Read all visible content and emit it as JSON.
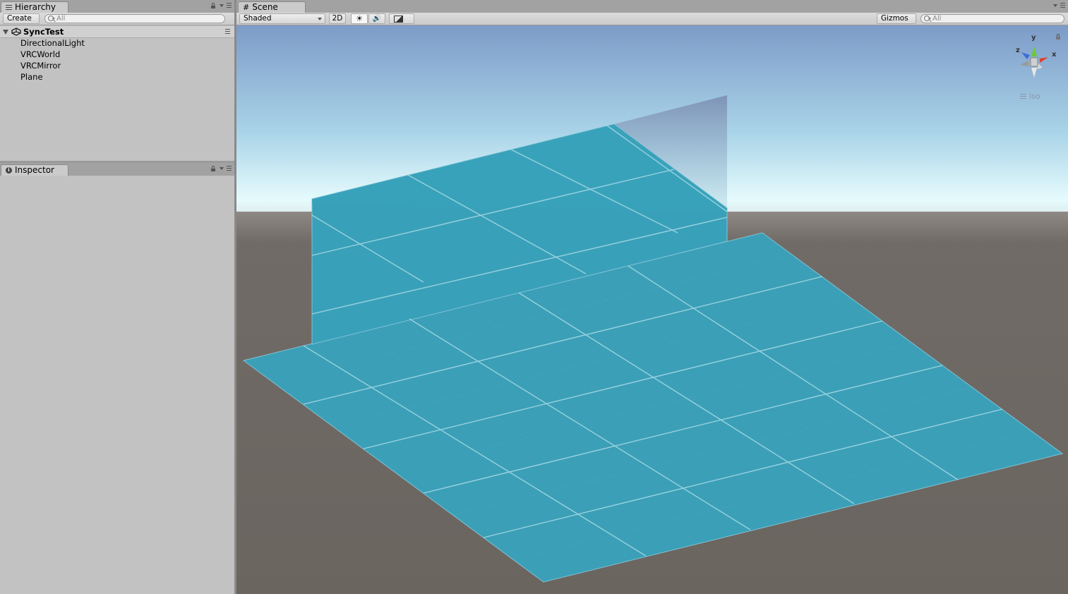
{
  "hierarchy": {
    "tab_label": "Hierarchy",
    "create_label": "Create",
    "search_placeholder": "All",
    "scene_name": "SyncTest",
    "items": [
      {
        "label": "DirectionalLight"
      },
      {
        "label": "VRCWorld"
      },
      {
        "label": "VRCMirror"
      },
      {
        "label": "Plane"
      }
    ]
  },
  "inspector": {
    "tab_label": "Inspector"
  },
  "scene": {
    "tab_label": "Scene",
    "draw_mode": "Shaded",
    "mode_2d": "2D",
    "gizmos_label": "Gizmos",
    "search_placeholder": "All",
    "projection_label": "Iso",
    "axis_labels": {
      "x": "x",
      "y": "y",
      "z": "z"
    }
  },
  "colors": {
    "panel_bg": "#c2c2c2",
    "sky_top": "#7f9dc9",
    "horizon": "#e8fbfd",
    "ground": "#6b6560",
    "plane": "#3a9eb6",
    "gizmo_x": "#e33c25",
    "gizmo_y": "#6ccc2f",
    "gizmo_z": "#3c6ed8"
  }
}
